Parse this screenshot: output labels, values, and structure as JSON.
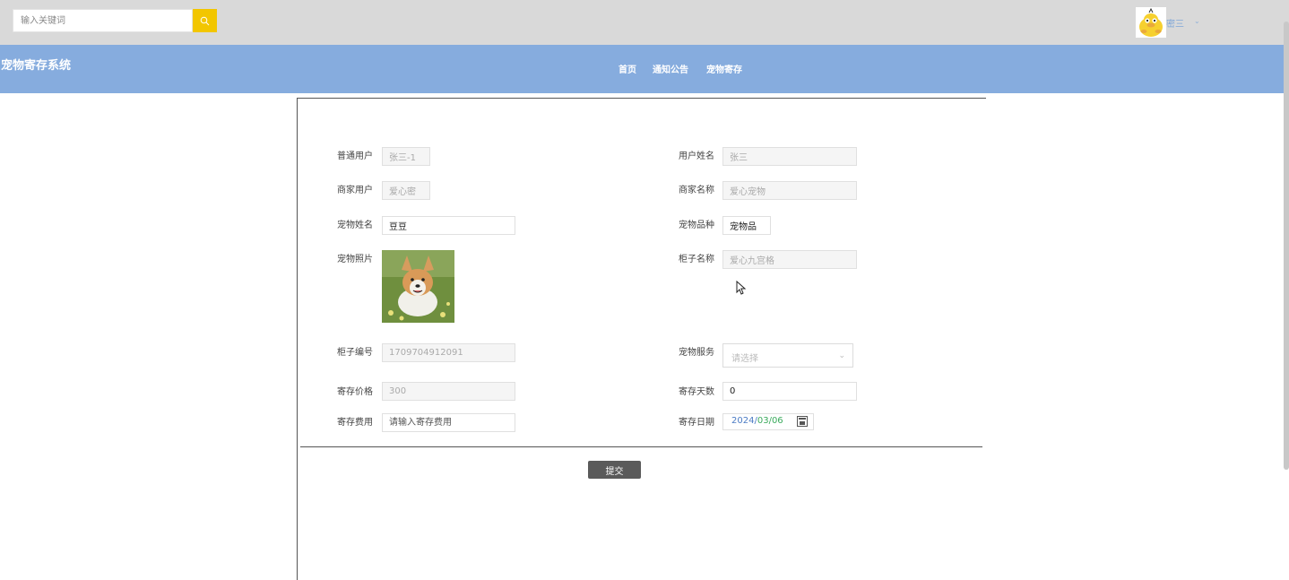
{
  "search": {
    "placeholder": "输入关键词"
  },
  "user": {
    "name": "密三"
  },
  "header": {
    "site_title": "宠物寄存系统",
    "nav": [
      "首页",
      "通知公告",
      "宠物寄存"
    ]
  },
  "form": {
    "user_account": {
      "label": "普通用户",
      "value": "张三-1"
    },
    "user_name": {
      "label": "用户姓名",
      "value": "张三"
    },
    "merchant_account": {
      "label": "商家用户",
      "value": "爱心密"
    },
    "merchant_name": {
      "label": "商家名称",
      "value": "爱心宠物"
    },
    "pet_name": {
      "label": "宠物姓名",
      "value": "豆豆"
    },
    "pet_type": {
      "label": "宠物品种",
      "value": "宠物品"
    },
    "pet_photo": {
      "label": "宠物照片"
    },
    "cabinet_name": {
      "label": "柜子名称",
      "value": "爱心九宫格"
    },
    "cabinet_no": {
      "label": "柜子编号",
      "value": "1709704912091"
    },
    "pet_service": {
      "label": "宠物服务",
      "placeholder": "请选择"
    },
    "deposit_price": {
      "label": "寄存价格",
      "value": "300"
    },
    "deposit_days": {
      "label": "寄存天数",
      "value": "0"
    },
    "deposit_fee": {
      "label": "寄存费用",
      "placeholder": "请输入寄存费用"
    },
    "deposit_date": {
      "label": "寄存日期",
      "year": "2024",
      "month": "03",
      "day": "06"
    },
    "submit_label": "提交"
  }
}
